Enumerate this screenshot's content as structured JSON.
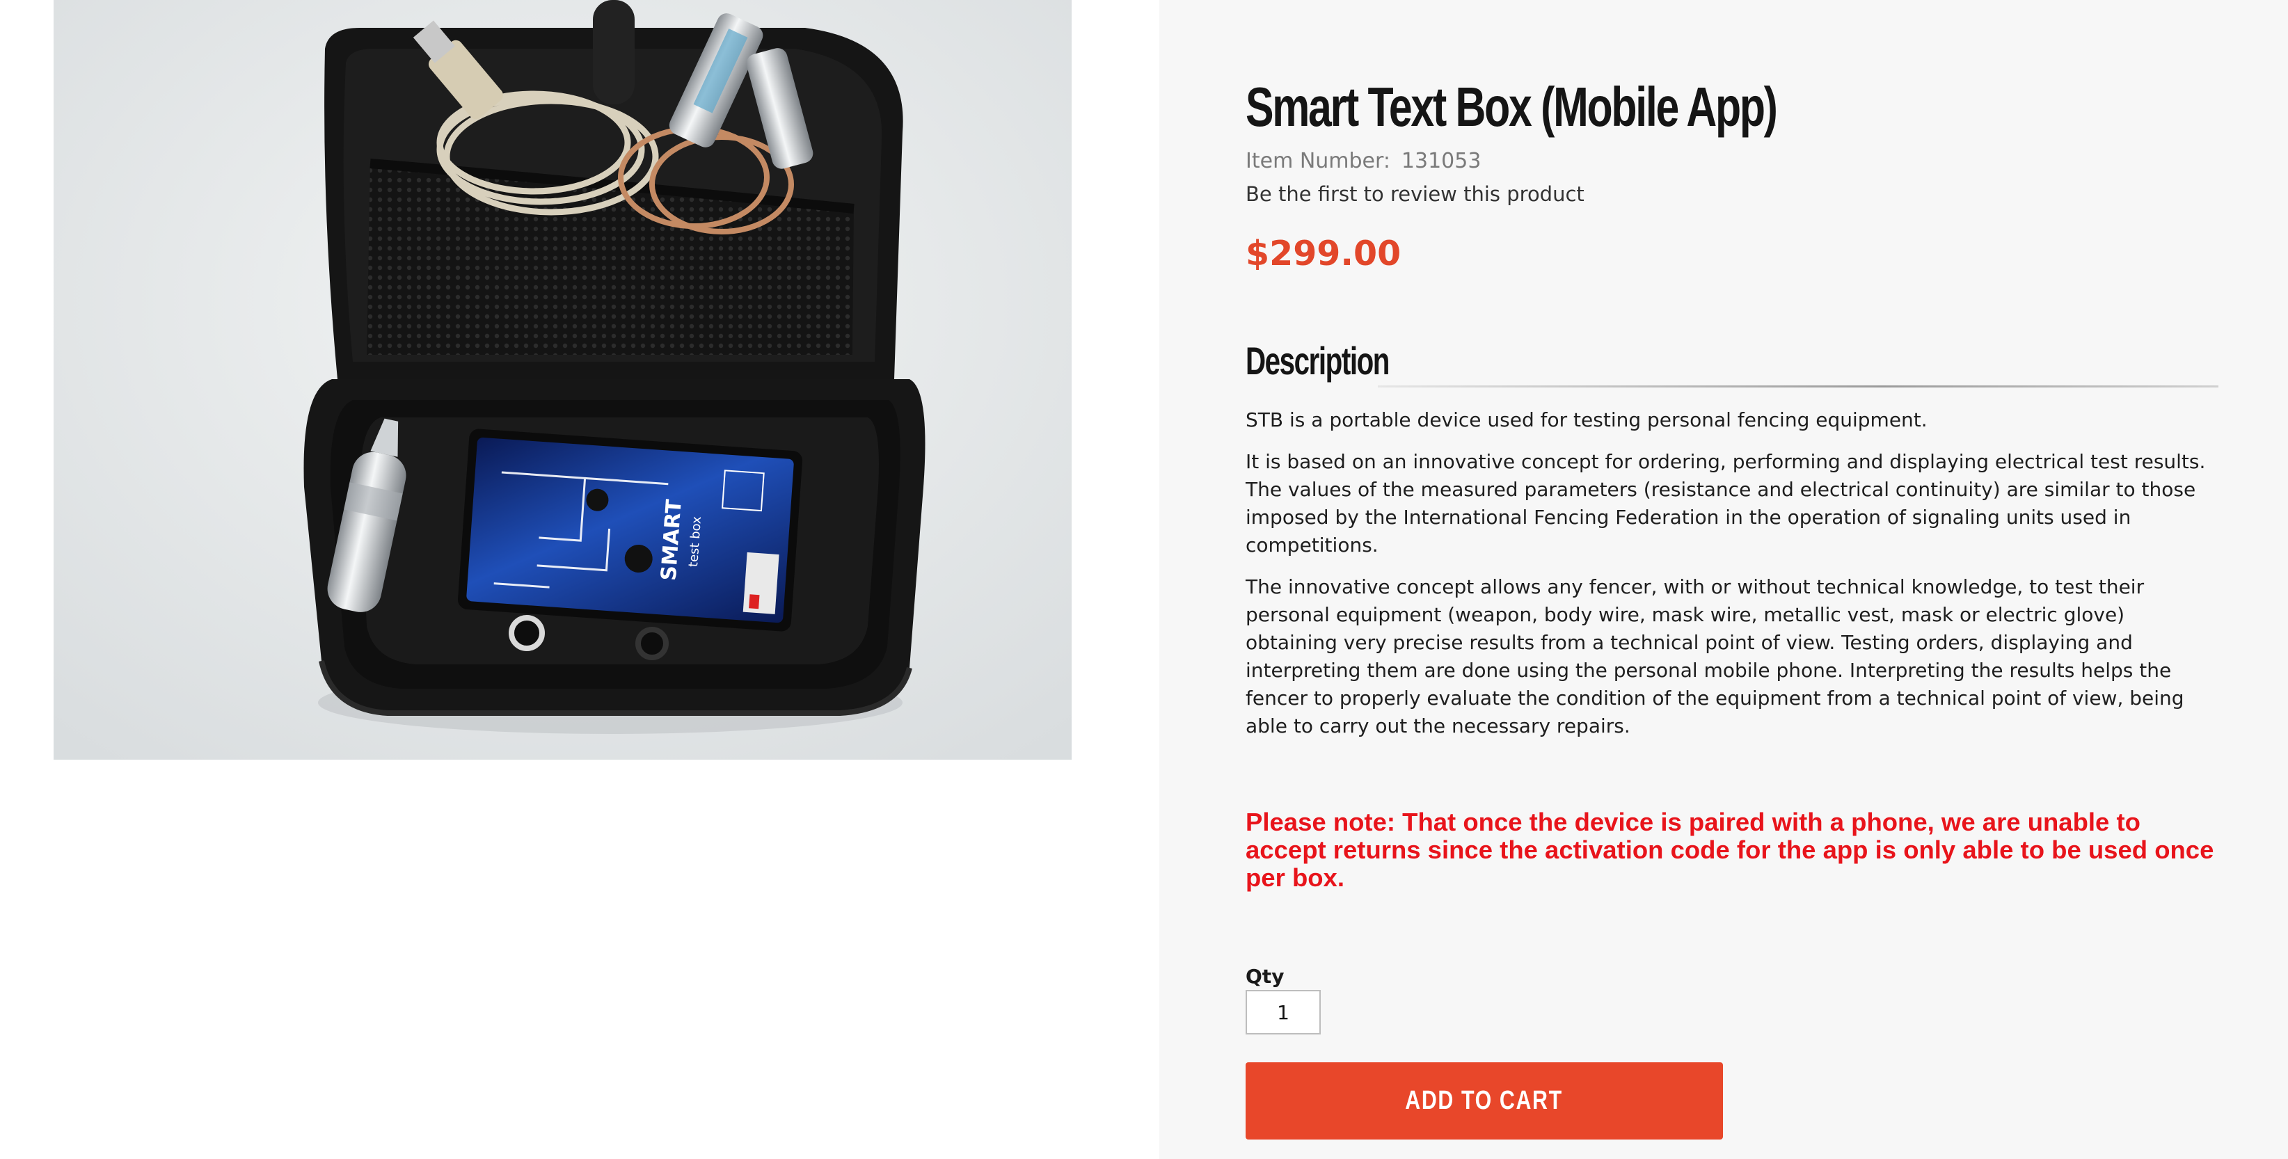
{
  "product": {
    "title": "Smart Text Box (Mobile App)",
    "item_number_label": "Item Number:",
    "item_number": "131053",
    "review_link": "Be the first to review this product",
    "price": "$299.00"
  },
  "image": {
    "device_text": [
      "SMART",
      "test box"
    ]
  },
  "description": {
    "heading": "Description",
    "paragraphs": [
      "STB  is a portable device used for testing personal fencing equipment.",
      "It is based on an innovative concept for ordering, performing and displaying electrical test results. The values of the measured parameters (resistance and electrical continuity) are similar to those imposed by the International Fencing Federation in the operation of signaling units used in competitions.",
      "The innovative concept allows any fencer, with or without technical knowledge, to test their personal equipment (weapon, body wire, mask wire, metallic vest, mask or electric glove) obtaining very precise results from a technical point of view. Testing orders, displaying and interpreting them are done using the personal mobile phone. Interpreting the results helps the fencer to properly evaluate the condition of the equipment from a technical point of view, being able to carry out the necessary repairs."
    ]
  },
  "notice": "Please note:  That once the device is paired with a phone, we are unable to accept returns since the activation code for the app is only able to be used once per box.",
  "cart": {
    "qty_label": "Qty",
    "qty_value": "1",
    "add_to_cart_label": "ADD TO CART"
  },
  "colors": {
    "accent": "#e8472a",
    "price": "#e2472a",
    "notice": "#e8141b",
    "panel_bg": "#f7f7f7"
  }
}
